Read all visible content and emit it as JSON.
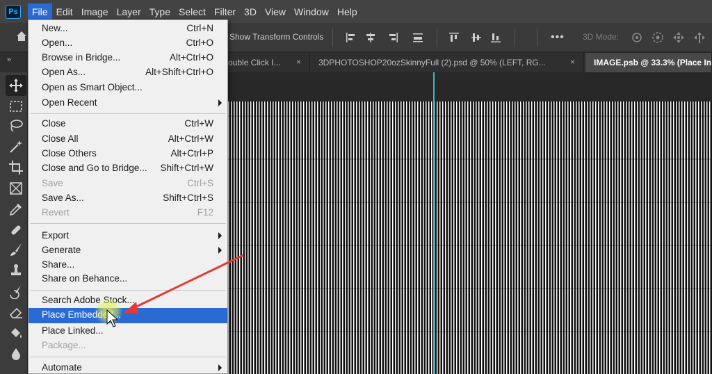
{
  "menubar": {
    "logo": "Ps",
    "items": [
      "File",
      "Edit",
      "Image",
      "Layer",
      "Type",
      "Select",
      "Filter",
      "3D",
      "View",
      "Window",
      "Help"
    ]
  },
  "options": {
    "transform_label": "Show Transform Controls",
    "mode_label": "3D Mode:",
    "more": "•••"
  },
  "tabs": [
    {
      "label": "ouble Click I...",
      "close": "×"
    },
    {
      "label": "3DPHOTOSHOP20ozSkinnyFull (2).psd @ 50% (LEFT, RG...",
      "close": "×"
    },
    {
      "label": "IMAGE.psb @ 33.3% (Place In",
      "close": ""
    }
  ],
  "collapse": "»",
  "file_menu": {
    "groups": [
      [
        {
          "label": "New...",
          "shortcut": "Ctrl+N"
        },
        {
          "label": "Open...",
          "shortcut": "Ctrl+O"
        },
        {
          "label": "Browse in Bridge...",
          "shortcut": "Alt+Ctrl+O"
        },
        {
          "label": "Open As...",
          "shortcut": "Alt+Shift+Ctrl+O"
        },
        {
          "label": "Open as Smart Object...",
          "shortcut": ""
        },
        {
          "label": "Open Recent",
          "shortcut": "",
          "submenu": true
        }
      ],
      [
        {
          "label": "Close",
          "shortcut": "Ctrl+W"
        },
        {
          "label": "Close All",
          "shortcut": "Alt+Ctrl+W"
        },
        {
          "label": "Close Others",
          "shortcut": "Alt+Ctrl+P"
        },
        {
          "label": "Close and Go to Bridge...",
          "shortcut": "Shift+Ctrl+W"
        },
        {
          "label": "Save",
          "shortcut": "Ctrl+S",
          "disabled": true
        },
        {
          "label": "Save As...",
          "shortcut": "Shift+Ctrl+S"
        },
        {
          "label": "Revert",
          "shortcut": "F12",
          "disabled": true
        }
      ],
      [
        {
          "label": "Export",
          "shortcut": "",
          "submenu": true
        },
        {
          "label": "Generate",
          "shortcut": "",
          "submenu": true
        },
        {
          "label": "Share...",
          "shortcut": ""
        },
        {
          "label": "Share on Behance...",
          "shortcut": ""
        }
      ],
      [
        {
          "label": "Search Adobe Stock...",
          "shortcut": ""
        },
        {
          "label": "Place Embedded...",
          "shortcut": "",
          "highlight": true
        },
        {
          "label": "Place Linked...",
          "shortcut": ""
        },
        {
          "label": "Package...",
          "shortcut": "",
          "disabled": true
        }
      ],
      [
        {
          "label": "Automate",
          "shortcut": "",
          "submenu": true
        }
      ]
    ]
  },
  "colors": {
    "menu_highlight": "#2a6ad3",
    "arrow": "#e53935",
    "guide": "#3fb6d8"
  }
}
